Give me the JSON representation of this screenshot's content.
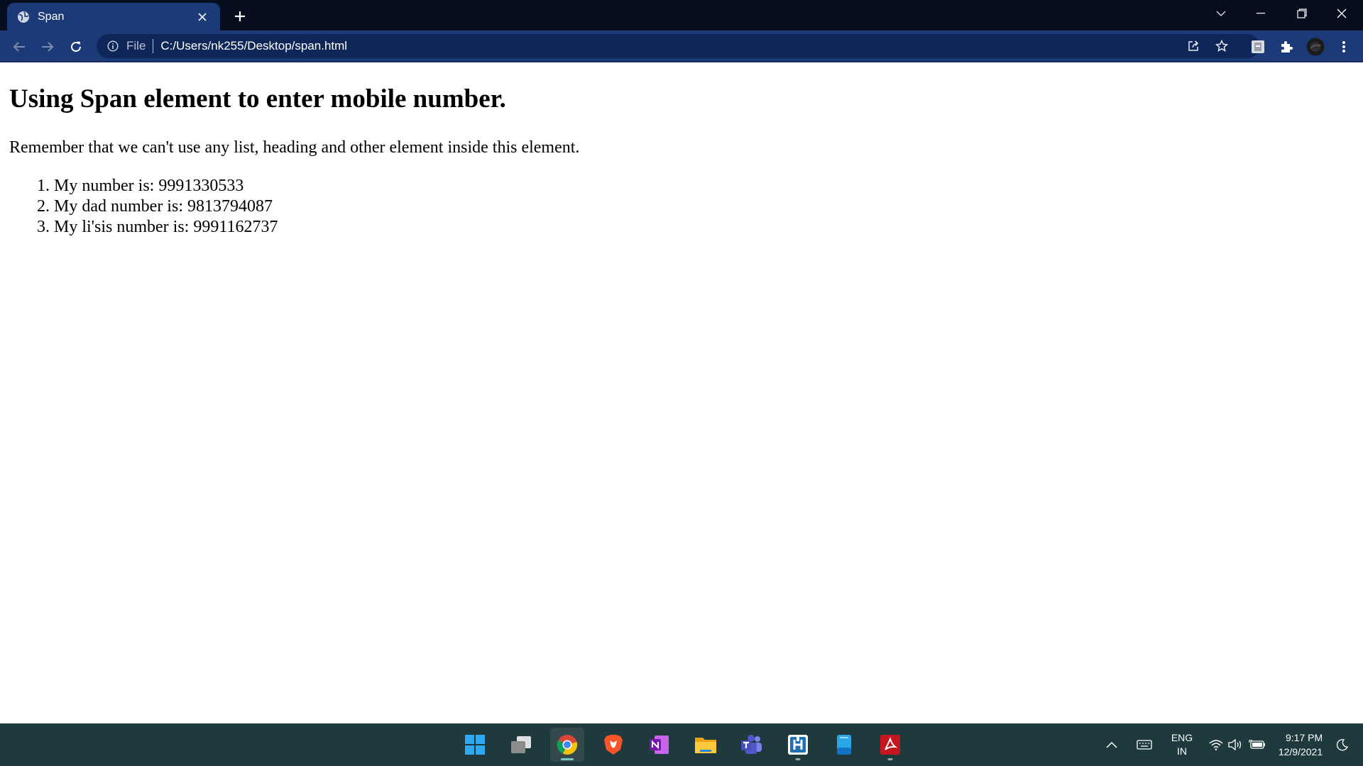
{
  "browser": {
    "tab_title": "Span",
    "omnibox": {
      "scheme": "File",
      "url": "C:/Users/nk255/Desktop/span.html"
    },
    "colors": {
      "tabstrip": "#060d1f",
      "toolbar": "#1c3a78",
      "omnibox": "#0f2658"
    }
  },
  "page": {
    "heading": "Using Span element to enter mobile number.",
    "paragraph": "Remember that we can't use any list, heading and other element inside this element.",
    "list_items": [
      "My number is: 9991330533",
      "My dad number is: 9813794087",
      "My li'sis number is: 9991162737"
    ]
  },
  "taskbar": {
    "apps": [
      "start-icon",
      "task-view-icon",
      "chrome-icon",
      "brave-icon",
      "onenote-icon",
      "file-explorer-icon",
      "teams-icon",
      "app-icon",
      "file-icon",
      "acrobat-icon"
    ],
    "language_line1": "ENG",
    "language_line2": "IN",
    "time": "9:17 PM",
    "date": "12/9/2021",
    "color": "#1f3a3d"
  }
}
